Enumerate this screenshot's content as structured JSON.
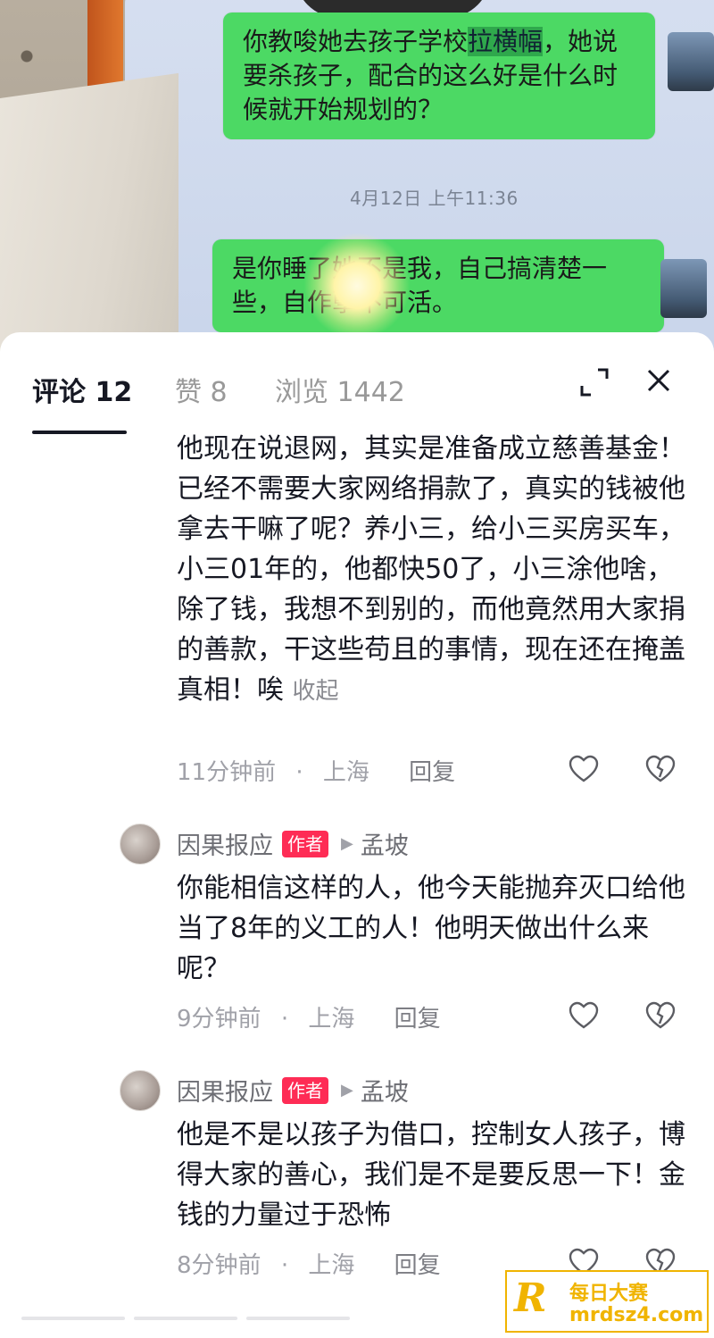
{
  "chat": {
    "bubble1_pre": "你教唆她去孩子学校",
    "bubble1_highlight": "拉横幅",
    "bubble1_post": "，她说要杀孩子，配合的这么好是什么时候就开始规划的？",
    "timestamp": "4月12日 上午11:36",
    "bubble2": "是你睡了她不是我，自己搞清楚一些，自作孽不可活。"
  },
  "tabs": [
    {
      "label": "评论 12"
    },
    {
      "label": "赞 8"
    },
    {
      "label": "浏览 1442"
    }
  ],
  "comments": [
    {
      "text": "他现在说退网，其实是准备成立慈善基金！已经不需要大家网络捐款了，真实的钱被他拿去干嘛了呢？养小三，给小三买房买车，小三01年的，他都快50了，小三涂他啥，除了钱，我想不到别的，而他竟然用大家捐的善款，干这些苟且的事情，现在还在掩盖真相！唉",
      "collapse": "收起",
      "time": "11分钟前",
      "location": "上海",
      "reply": "回复"
    },
    {
      "user": "因果报应",
      "badge": "作者",
      "reply_to": "孟坡",
      "text": "你能相信这样的人，他今天能抛弃灭口给他当了8年的义工的人！他明天做出什么来呢？",
      "time": "9分钟前",
      "location": "上海",
      "reply": "回复"
    },
    {
      "user": "因果报应",
      "badge": "作者",
      "reply_to": "孟坡",
      "text": "他是不是以孩子为借口，控制女人孩子，博得大家的善心，我们是不是要反思一下！金钱的力量过于恐怖",
      "time": "8分钟前",
      "location": "上海",
      "reply": "回复"
    }
  ],
  "separator": "·",
  "watermark": {
    "letter": "R",
    "cn": "每日大赛",
    "en": "mrdsz4.com"
  },
  "colors": {
    "accent": "#fe2c55",
    "bubble": "#4cd964",
    "watermark": "#f0b400"
  }
}
